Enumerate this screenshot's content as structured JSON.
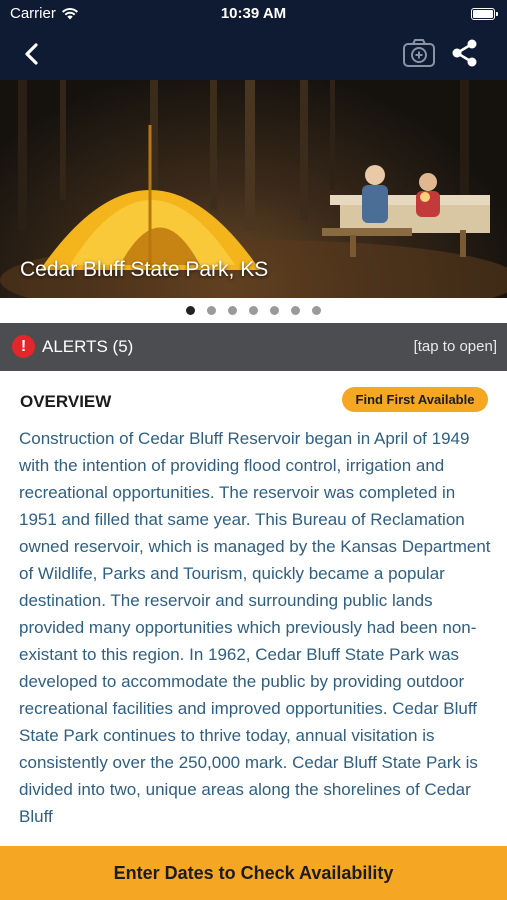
{
  "status_bar": {
    "carrier": "Carrier",
    "time": "10:39 AM"
  },
  "nav": {
    "back_icon": "chevron-left-icon",
    "add_photo_icon": "camera-plus-icon",
    "share_icon": "share-icon"
  },
  "hero": {
    "title": "Cedar Bluff State Park, KS",
    "slide_count": 7,
    "active_slide": 1
  },
  "alerts": {
    "label": "ALERTS (5)",
    "hint": "[tap to open]",
    "icon": "!"
  },
  "overview": {
    "heading": "OVERVIEW",
    "find_button": "Find First Available",
    "text": "Construction of Cedar Bluff Reservoir began in April of 1949 with the intention of providing flood control, irrigation and recreational opportunities. The reservoir was completed in 1951 and filled that same year. This Bureau of Reclamation owned reservoir, which is managed by the Kansas Department of Wildlife, Parks and Tourism, quickly became a popular destination. The reservoir and surrounding public lands provided many opportunities which previously had been non-existant to this region. In 1962, Cedar Bluff State Park was developed to accommodate the public by providing outdoor recreational facilities and improved opportunities. Cedar Bluff State Park continues to thrive today, annual visitation is consistently over the 250,000 mark. Cedar Bluff State Park is divided into two, unique areas along the shorelines of Cedar Bluff"
  },
  "cta": {
    "label": "Enter Dates to Check Availability"
  },
  "colors": {
    "nav_bg": "#0f1a33",
    "accent": "#f5a623",
    "alert_bar": "#4b4d51",
    "alert_red": "#e2262c",
    "body_text": "#2f5f82"
  }
}
